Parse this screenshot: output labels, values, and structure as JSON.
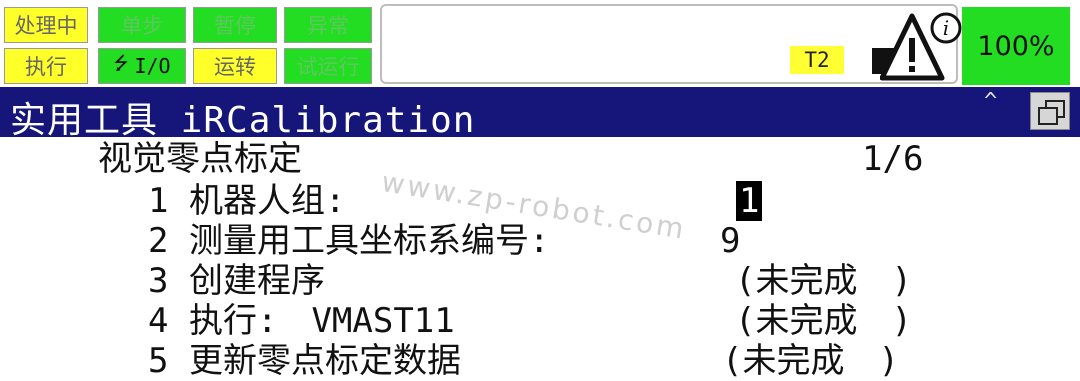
{
  "status_bar": {
    "busy": "处理中",
    "step": "单步",
    "hold": "暂停",
    "fault": "异常",
    "run": "执行",
    "io": "I/O",
    "prod": "运转",
    "tcyc": "试运行",
    "mode": "T2",
    "override": "100%"
  },
  "title_bar": {
    "title": "实用工具 iRCalibration",
    "caret": "^"
  },
  "screen": {
    "heading": "视觉零点标定",
    "page": "1/6",
    "items": [
      {
        "num": "1",
        "label": "机器人组:",
        "value": "1"
      },
      {
        "num": "2",
        "label": "测量用工具坐标系编号:",
        "value": "9"
      },
      {
        "num": "3",
        "label": "创建程序",
        "value": "(未完成　)"
      },
      {
        "num": "4",
        "label": "执行:　VMAST11",
        "value": "(未完成　)"
      },
      {
        "num": "5",
        "label": "更新零点标定数据",
        "value": "(未完成　)"
      }
    ]
  },
  "watermark": "www.zp-robot.com",
  "colors": {
    "title_bg": "#15157a",
    "yellow": "#ffff2a",
    "green": "#22dd22"
  }
}
